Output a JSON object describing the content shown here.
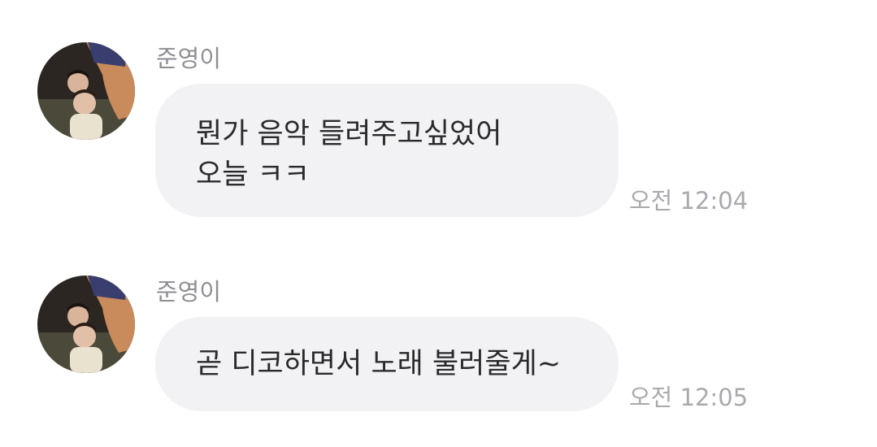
{
  "conversation": {
    "messages": [
      {
        "sender": "준영이",
        "lines": [
          "뭔가 음악 들려주고싶었어",
          "오늘 ㅋㅋ"
        ],
        "time": "오전 12:04",
        "avatar_icon": "profile-photo-icon"
      },
      {
        "sender": "준영이",
        "lines": [
          "곧 디코하면서 노래 불러줄게~"
        ],
        "time": "오전 12:05",
        "avatar_icon": "profile-photo-icon"
      }
    ]
  },
  "colors": {
    "bubble": "#f2f2f5",
    "sender": "#8e8e93",
    "time": "#a9a9ae",
    "text": "#2a2a2a"
  }
}
